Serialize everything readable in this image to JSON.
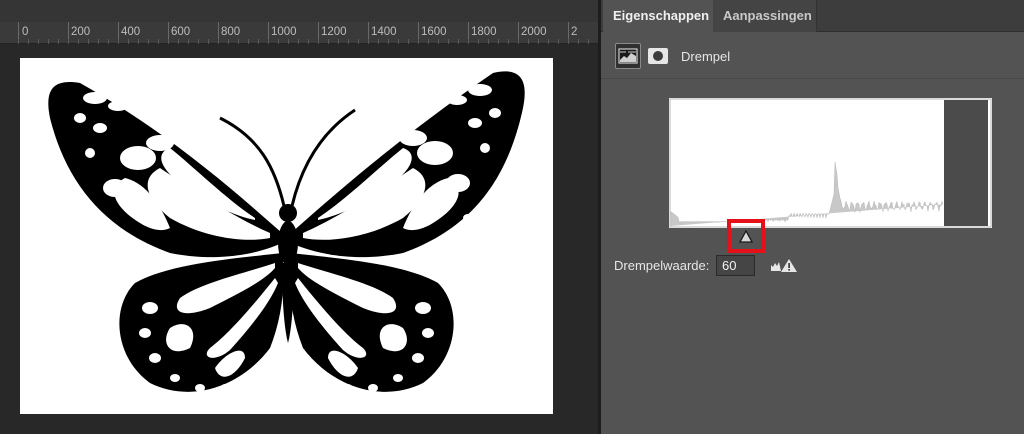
{
  "ruler": {
    "labels": [
      "0",
      "200",
      "400",
      "600",
      "800",
      "1000",
      "1200",
      "1400",
      "1600",
      "1800",
      "2000",
      "2"
    ]
  },
  "panel": {
    "tabs": [
      {
        "label": "Eigenschappen",
        "active": true
      },
      {
        "label": "Aanpassingen",
        "active": false
      }
    ],
    "adjustment": {
      "title": "Drempel",
      "adjustment_icon": "threshold-adjustment-icon",
      "mask_icon": "layer-mask-icon"
    },
    "threshold": {
      "label": "Drempelwaarde:",
      "value": "60",
      "warning_icon": "histogram-warning-icon"
    },
    "highlight_color": "#e4101a"
  },
  "document": {
    "image": "butterfly-silhouette-black-white"
  }
}
